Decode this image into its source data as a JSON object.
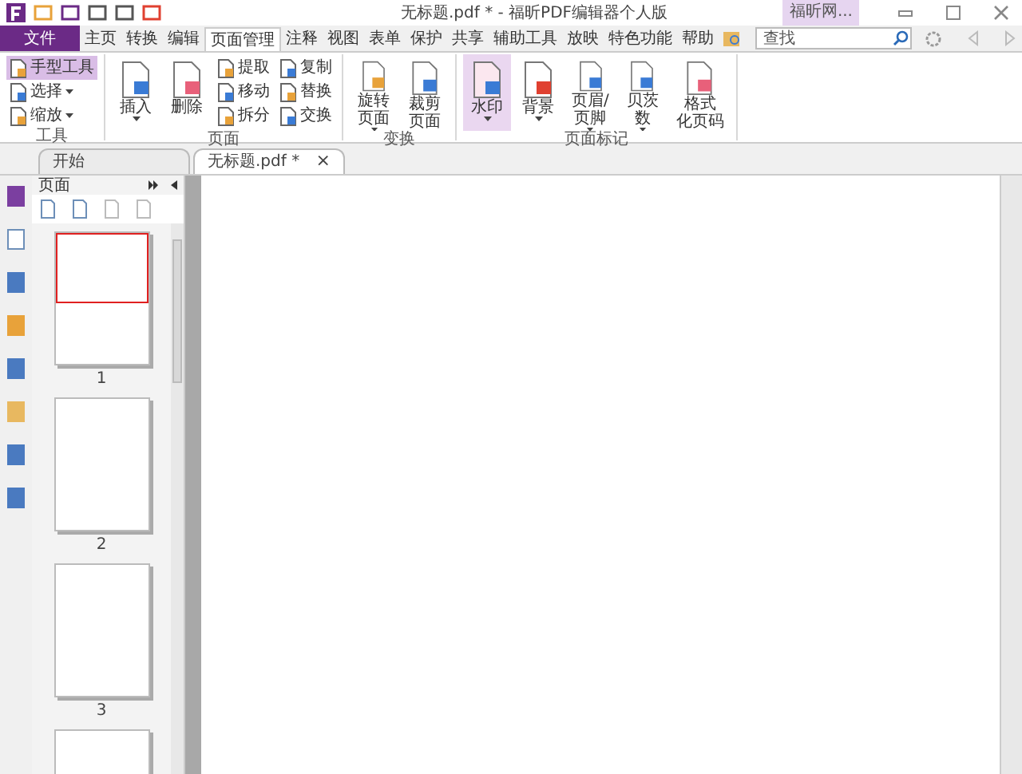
{
  "window": {
    "title": "无标题.pdf * - 福昕PDF编辑器个人版",
    "account": "福昕网..."
  },
  "menu": [
    {
      "label": "文件",
      "kind": "file",
      "selected": false
    },
    {
      "label": "主页",
      "kind": "tab",
      "selected": false
    },
    {
      "label": "转换",
      "kind": "tab",
      "selected": false
    },
    {
      "label": "编辑",
      "kind": "tab",
      "selected": false
    },
    {
      "label": "页面管理",
      "kind": "tab",
      "selected": true
    },
    {
      "label": "注释",
      "kind": "tab",
      "selected": false
    },
    {
      "label": "视图",
      "kind": "tab",
      "selected": false
    },
    {
      "label": "表单",
      "kind": "tab",
      "selected": false
    },
    {
      "label": "保护",
      "kind": "tab",
      "selected": false
    },
    {
      "label": "共享",
      "kind": "tab",
      "selected": false
    },
    {
      "label": "辅助工具",
      "kind": "tab",
      "selected": false
    },
    {
      "label": "放映",
      "kind": "tab",
      "selected": false
    },
    {
      "label": "特色功能",
      "kind": "tab",
      "selected": false
    },
    {
      "label": "帮助",
      "kind": "tab",
      "selected": false
    }
  ],
  "search": {
    "placeholder": "查找"
  },
  "ribbon": [
    {
      "label": "工具",
      "items": [
        {
          "kind": "small",
          "lines": [
            "手型工具"
          ],
          "selected": true,
          "dropdown": false
        },
        {
          "kind": "small",
          "lines": [
            "选择"
          ],
          "selected": false,
          "dropdown": true
        },
        {
          "kind": "small",
          "lines": [
            "缩放"
          ],
          "selected": false,
          "dropdown": true
        }
      ]
    },
    {
      "label": "页面",
      "items": [
        {
          "kind": "large",
          "lines": [
            "插入"
          ],
          "selected": false,
          "dropdown": true
        },
        {
          "kind": "large",
          "lines": [
            "删除"
          ],
          "selected": false,
          "dropdown": false
        },
        {
          "kind": "small",
          "lines": [
            "提取"
          ],
          "selected": false,
          "dropdown": false
        },
        {
          "kind": "small",
          "lines": [
            "移动"
          ],
          "selected": false,
          "dropdown": false
        },
        {
          "kind": "small",
          "lines": [
            "拆分"
          ],
          "selected": false,
          "dropdown": false
        },
        {
          "kind": "small",
          "lines": [
            "复制"
          ],
          "selected": false,
          "dropdown": false
        },
        {
          "kind": "small",
          "lines": [
            "替换"
          ],
          "selected": false,
          "dropdown": false
        },
        {
          "kind": "small",
          "lines": [
            "交换"
          ],
          "selected": false,
          "dropdown": false
        }
      ]
    },
    {
      "label": "变换",
      "items": [
        {
          "kind": "large",
          "lines": [
            "旋转",
            "页面"
          ],
          "selected": false,
          "dropdown": true
        },
        {
          "kind": "large",
          "lines": [
            "裁剪",
            "页面"
          ],
          "selected": false,
          "dropdown": false
        }
      ]
    },
    {
      "label": "页面标记",
      "items": [
        {
          "kind": "large",
          "lines": [
            "水印"
          ],
          "selected": true,
          "dropdown": true
        },
        {
          "kind": "large",
          "lines": [
            "背景"
          ],
          "selected": false,
          "dropdown": true
        },
        {
          "kind": "large",
          "lines": [
            "页眉/",
            "页脚"
          ],
          "selected": false,
          "dropdown": true
        },
        {
          "kind": "large",
          "lines": [
            "贝茨",
            "数"
          ],
          "selected": false,
          "dropdown": true
        },
        {
          "kind": "large",
          "lines": [
            "格式",
            "化页码"
          ],
          "selected": false,
          "dropdown": false
        }
      ]
    }
  ],
  "doc_tabs": [
    {
      "label": "开始",
      "selected": false,
      "closable": false
    },
    {
      "label": "无标题.pdf *",
      "selected": true,
      "closable": true
    }
  ],
  "close_glyph": "×",
  "panel": {
    "title": "页面",
    "pages": [
      {
        "label": "1",
        "selected": true
      },
      {
        "label": "2",
        "selected": false
      },
      {
        "label": "3",
        "selected": false
      },
      {
        "selected": false
      }
    ]
  }
}
